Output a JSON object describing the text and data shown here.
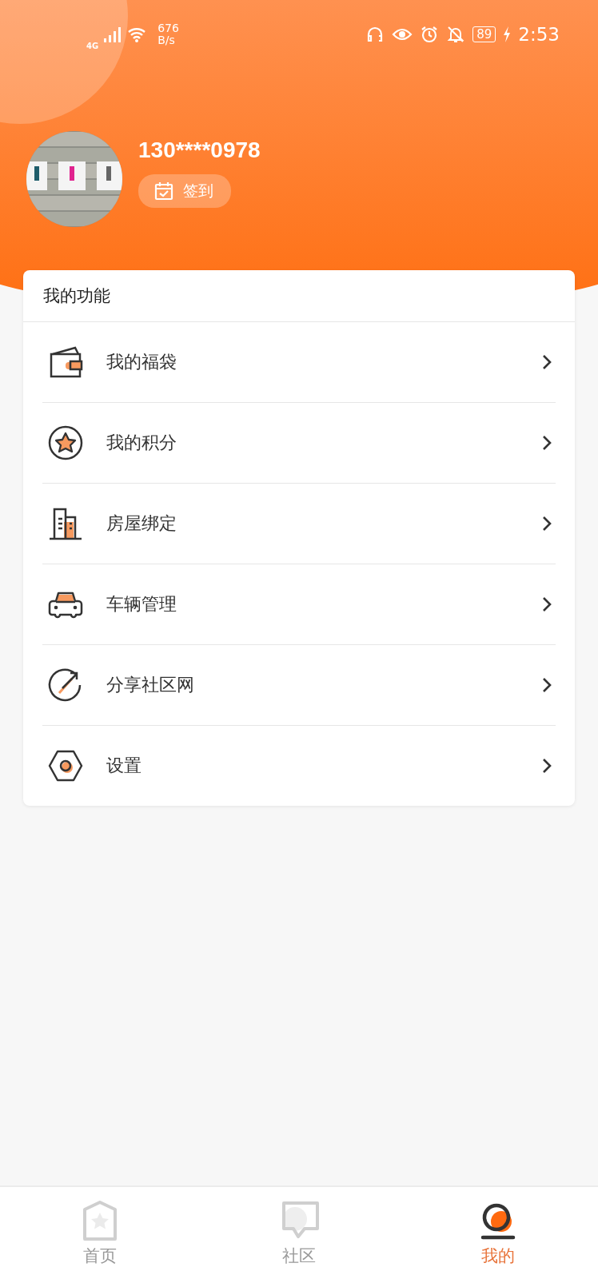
{
  "status_bar": {
    "network": "4G",
    "speed_value": "676",
    "speed_unit": "B/s",
    "battery": "89",
    "time": "2:53"
  },
  "profile": {
    "phone": "130****0978",
    "checkin_label": "签到"
  },
  "functions": {
    "title": "我的功能",
    "items": [
      {
        "kind": "wallet",
        "label": "我的福袋"
      },
      {
        "kind": "points",
        "label": "我的积分"
      },
      {
        "kind": "house",
        "label": "房屋绑定"
      },
      {
        "kind": "car",
        "label": "车辆管理"
      },
      {
        "kind": "share",
        "label": "分享社区网"
      },
      {
        "kind": "settings",
        "label": "设置"
      }
    ]
  },
  "tab_bar": [
    {
      "kind": "home",
      "label": "首页",
      "selected": false
    },
    {
      "kind": "community",
      "label": "社区",
      "selected": false
    },
    {
      "kind": "mine",
      "label": "我的",
      "selected": true
    }
  ]
}
